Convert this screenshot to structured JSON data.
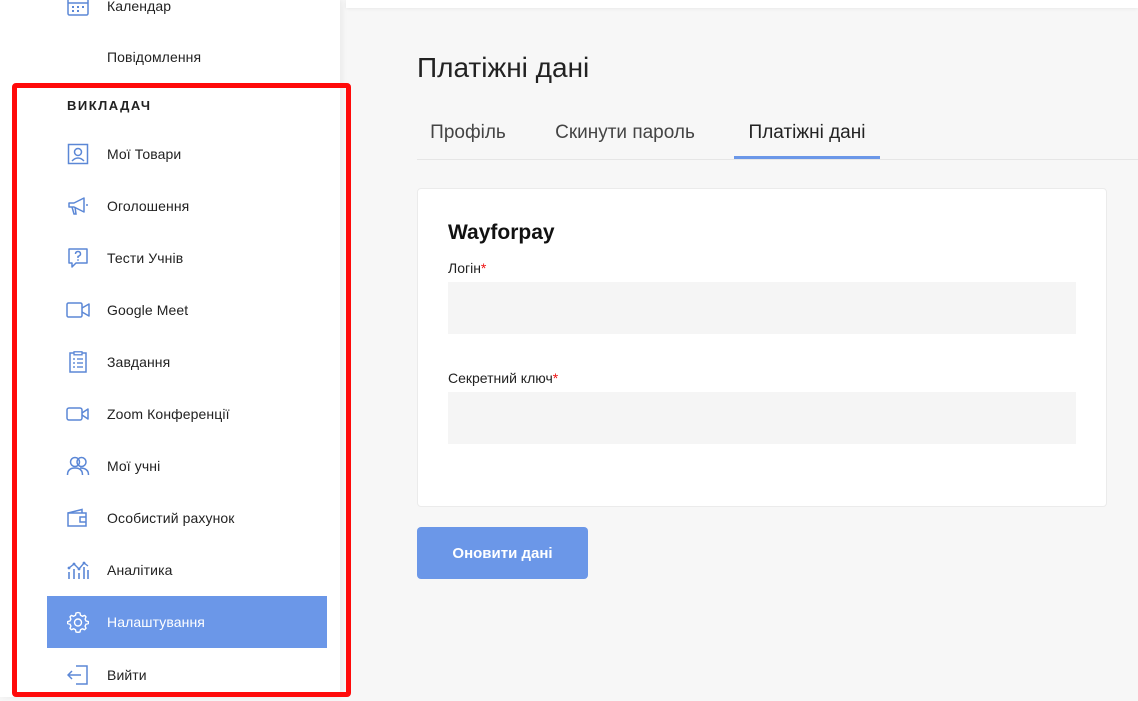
{
  "sidebar": {
    "top_items": [
      {
        "label": "Календар",
        "icon": "calendar-icon"
      },
      {
        "label": "Повідомлення",
        "icon": ""
      }
    ],
    "section_title": "ВИКЛАДАЧ",
    "items": [
      {
        "label": "Мої Товари",
        "icon": "products-icon"
      },
      {
        "label": "Оголошення",
        "icon": "megaphone-icon"
      },
      {
        "label": "Тести Учнів",
        "icon": "question-icon"
      },
      {
        "label": "Google Meet",
        "icon": "video-camera-icon"
      },
      {
        "label": "Завдання",
        "icon": "checklist-icon"
      },
      {
        "label": "Zoom Конференції",
        "icon": "zoom-camera-icon"
      },
      {
        "label": "Мої учні",
        "icon": "users-icon"
      },
      {
        "label": "Особистий рахунок",
        "icon": "wallet-icon"
      },
      {
        "label": "Аналітика",
        "icon": "analytics-icon"
      },
      {
        "label": "Налаштування",
        "icon": "gear-icon",
        "active": true
      },
      {
        "label": "Вийти",
        "icon": "logout-icon"
      }
    ]
  },
  "main": {
    "title": "Платіжні дані",
    "tabs": [
      {
        "label": "Профіль"
      },
      {
        "label": "Скинути пароль"
      },
      {
        "label": "Платіжні дані",
        "active": true
      }
    ],
    "card": {
      "title": "Wayforpay",
      "login_label": "Логін",
      "login_value": "",
      "secret_label": "Секретний ключ",
      "secret_value": "",
      "required_mark": "*"
    },
    "submit_label": "Оновити дані"
  },
  "colors": {
    "accent": "#6b97e8",
    "highlight": "#ff0a0a",
    "required": "#e11111"
  }
}
